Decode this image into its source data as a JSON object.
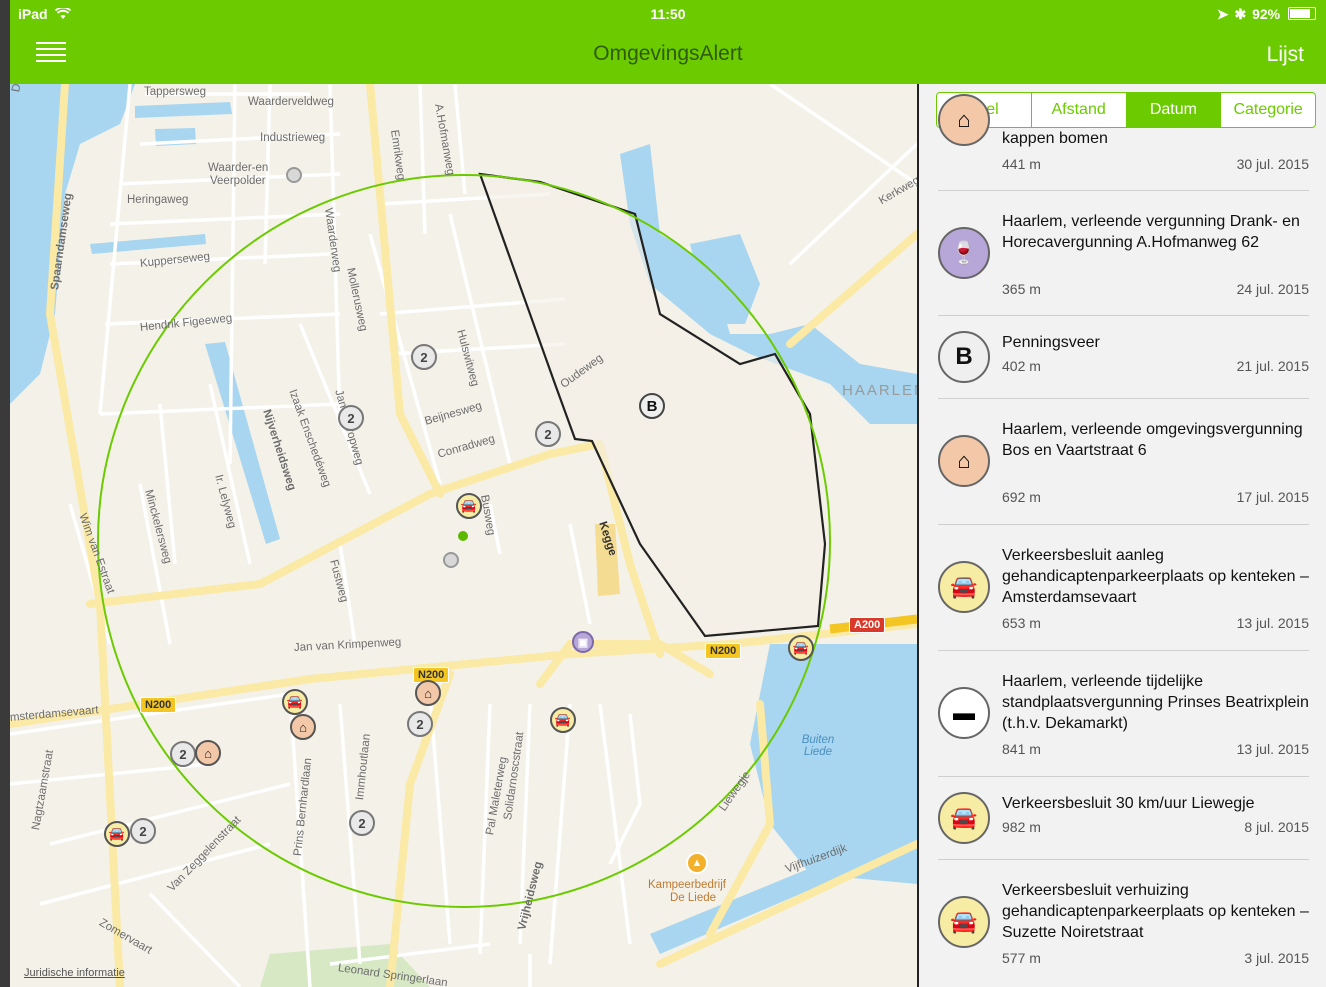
{
  "status_bar": {
    "device": "iPad",
    "time": "11:50",
    "battery": "92%",
    "battery_level": 0.92
  },
  "nav": {
    "title": "OmgevingsAlert",
    "list_button": "Lijst"
  },
  "map": {
    "legal_link": "Juridische informatie",
    "street_labels": [
      "Tappersweg",
      "Waarderveldweg",
      "Industrieweg",
      "Waarder-en",
      "Veerpolder",
      "Heringaweg",
      "Kupperseweg",
      "Hendrik Figeeweg",
      "Spaarndamseweg",
      "Emrikweg",
      "A.Hofmanweg",
      "Waarderweg",
      "Mollerusweg",
      "Hulswitweg",
      "Beijnesweg",
      "Conradweg",
      "Oudeweg",
      "Izaak Enschedéweg",
      "Nijverheidsweg",
      "Jan Tooropweg",
      "Ir. Lelyweg",
      "Minckelersweg",
      "Wim van Estraat",
      "Fustweg",
      "Busweg",
      "Kegge",
      "Jan van Krimpenweg",
      "msterdamsevaart",
      "Nagtzaamstraat",
      "Prins Bernhardlaan",
      "Immhoutlaan",
      "Pal Maleterweg",
      "Solidarnoscstraat",
      "Vrijheidsweg",
      "Van Zeggelenstraat",
      "Zomervaart",
      "Leonard Springerlaan",
      "Liewegje",
      "Vijfhuizerdijk",
      "Kerkweg",
      "Buiten Liede",
      "Kampeerbedrijf",
      "De Liede",
      "HAARLEM",
      "De"
    ],
    "road_badges": [
      "N200",
      "N200",
      "N200",
      "A200"
    ],
    "pins": [
      "2",
      "2",
      "2",
      "2",
      "2",
      "2",
      "2",
      "B"
    ]
  },
  "sort_tabs": [
    {
      "label": "Titel",
      "active": false
    },
    {
      "label": "Afstand",
      "active": false
    },
    {
      "label": "Datum",
      "active": true
    },
    {
      "label": "Categorie",
      "active": false
    }
  ],
  "alerts": [
    {
      "icon": "house-icon",
      "icon_bg": "#f3c8a8",
      "title": "kappen bomen",
      "distance": "441 m",
      "date": "30 jul. 2015"
    },
    {
      "icon": "wine-icon",
      "icon_bg": "#b7a6d8",
      "title": "Haarlem, verleende vergunning Drank- en Horecavergunning A.Hofmanweg 62",
      "distance": "365 m",
      "date": "24 jul. 2015"
    },
    {
      "icon": "letter-b-icon",
      "icon_bg": "#efefef",
      "title": "Penningsveer",
      "distance": "402 m",
      "date": "21 jul. 2015"
    },
    {
      "icon": "house-icon",
      "icon_bg": "#f3c8a8",
      "title": "Haarlem, verleende omgevingsvergunning Bos en Vaartstraat 6",
      "distance": "692 m",
      "date": "17 jul. 2015"
    },
    {
      "icon": "car-icon",
      "icon_bg": "#f7eca3",
      "title": "Verkeersbesluit aanleg gehandicaptenparkeerplaats op kenteken – Amsterdamsevaart",
      "distance": "653 m",
      "date": "13 jul. 2015"
    },
    {
      "icon": "market-stall-icon",
      "icon_bg": "#ffffff",
      "title": "Haarlem, verleende tijdelijke standplaatsvergunning Prinses Beatrixplein (t.h.v. Dekamarkt)",
      "distance": "841 m",
      "date": "13 jul. 2015"
    },
    {
      "icon": "car-icon",
      "icon_bg": "#f7eca3",
      "title": "Verkeersbesluit 30 km/uur Liewegje",
      "distance": "982 m",
      "date": "8 jul. 2015"
    },
    {
      "icon": "car-icon",
      "icon_bg": "#f7eca3",
      "title": "Verkeersbesluit verhuizing gehandicaptenparkeerplaats op kenteken – Suzette Noiretstraat",
      "distance": "577 m",
      "date": "3 jul. 2015"
    }
  ],
  "colors": {
    "accent": "#6ccb00",
    "water": "#a8d5ef",
    "road": "#fbe9a6",
    "circle": "#6ccb00"
  }
}
